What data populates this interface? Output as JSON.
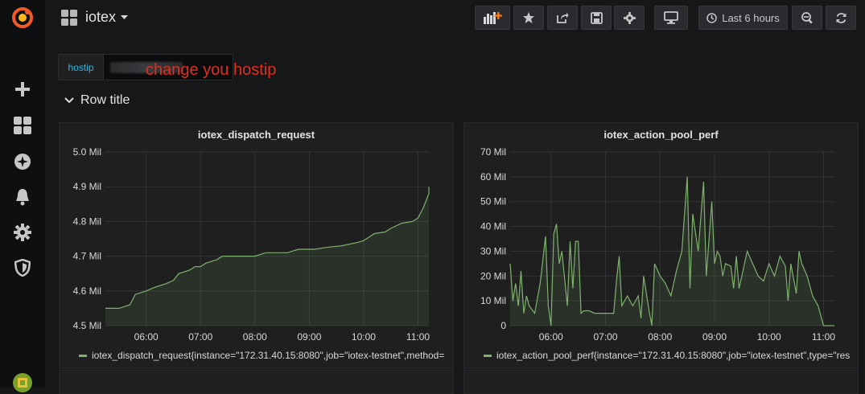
{
  "dashboard": {
    "title": "iotex"
  },
  "toolbar": {
    "time_range": "Last 6 hours"
  },
  "variable": {
    "label": "hostip"
  },
  "annotation": "change you hostip",
  "row": {
    "title": "Row title"
  },
  "colors": {
    "series": "#7eb26d",
    "accent": "#33b5e5",
    "annotation": "#e02f1f"
  },
  "panels": [
    {
      "title": "iotex_dispatch_request",
      "legend": "iotex_dispatch_request{instance=\"172.31.40.15:8080\",job=\"iotex-testnet\",method="
    },
    {
      "title": "iotex_action_pool_perf",
      "legend": "iotex_action_pool_perf{instance=\"172.31.40.15:8080\",job=\"iotex-testnet\",type=\"res"
    }
  ],
  "chart_data": [
    {
      "type": "area",
      "title": "iotex_dispatch_request",
      "y_tick_labels": [
        "4.5 Mil",
        "4.6 Mil",
        "4.7 Mil",
        "4.8 Mil",
        "4.9 Mil",
        "5.0 Mil"
      ],
      "x_tick_labels": [
        "06:00",
        "07:00",
        "08:00",
        "09:00",
        "10:00",
        "11:00"
      ],
      "ylim": [
        4.5,
        5.0
      ],
      "xlim": [
        5.25,
        11.2
      ],
      "series": [
        {
          "values": [
            [
              5.25,
              4.55
            ],
            [
              5.5,
              4.55
            ],
            [
              5.7,
              4.56
            ],
            [
              5.8,
              4.59
            ],
            [
              6.0,
              4.6
            ],
            [
              6.15,
              4.61
            ],
            [
              6.35,
              4.62
            ],
            [
              6.5,
              4.63
            ],
            [
              6.6,
              4.65
            ],
            [
              6.8,
              4.66
            ],
            [
              6.9,
              4.67
            ],
            [
              7.0,
              4.67
            ],
            [
              7.1,
              4.68
            ],
            [
              7.3,
              4.69
            ],
            [
              7.4,
              4.7
            ],
            [
              7.6,
              4.7
            ],
            [
              8.0,
              4.7
            ],
            [
              8.2,
              4.71
            ],
            [
              8.6,
              4.71
            ],
            [
              8.8,
              4.72
            ],
            [
              9.1,
              4.72
            ],
            [
              9.3,
              4.725
            ],
            [
              9.6,
              4.73
            ],
            [
              9.9,
              4.74
            ],
            [
              10.0,
              4.745
            ],
            [
              10.2,
              4.765
            ],
            [
              10.4,
              4.77
            ],
            [
              10.5,
              4.78
            ],
            [
              10.7,
              4.795
            ],
            [
              10.9,
              4.8
            ],
            [
              11.0,
              4.81
            ],
            [
              11.1,
              4.84
            ],
            [
              11.2,
              4.88
            ],
            [
              11.3,
              4.9
            ]
          ]
        }
      ]
    },
    {
      "type": "area",
      "title": "iotex_action_pool_perf",
      "y_tick_labels": [
        "0",
        "10 Mil",
        "20 Mil",
        "30 Mil",
        "40 Mil",
        "50 Mil",
        "60 Mil",
        "70 Mil"
      ],
      "x_tick_labels": [
        "06:00",
        "07:00",
        "08:00",
        "09:00",
        "10:00",
        "11:00"
      ],
      "ylim": [
        0,
        70
      ],
      "xlim": [
        5.25,
        11.2
      ],
      "series": [
        {
          "values": [
            [
              5.25,
              25
            ],
            [
              5.3,
              10
            ],
            [
              5.35,
              17
            ],
            [
              5.4,
              8
            ],
            [
              5.45,
              22
            ],
            [
              5.5,
              5
            ],
            [
              5.55,
              12
            ],
            [
              5.6,
              8
            ],
            [
              5.7,
              5
            ],
            [
              5.8,
              17
            ],
            [
              5.9,
              36
            ],
            [
              5.95,
              8
            ],
            [
              6.0,
              0
            ],
            [
              6.05,
              37
            ],
            [
              6.1,
              41
            ],
            [
              6.15,
              25
            ],
            [
              6.2,
              30
            ],
            [
              6.3,
              8
            ],
            [
              6.35,
              34
            ],
            [
              6.4,
              15
            ],
            [
              6.45,
              34
            ],
            [
              6.5,
              34
            ],
            [
              6.55,
              5
            ],
            [
              6.6,
              6
            ],
            [
              6.7,
              6
            ],
            [
              6.8,
              5
            ],
            [
              7.0,
              5
            ],
            [
              7.15,
              5
            ],
            [
              7.2,
              18
            ],
            [
              7.25,
              28
            ],
            [
              7.3,
              8
            ],
            [
              7.4,
              12
            ],
            [
              7.5,
              8
            ],
            [
              7.6,
              12
            ],
            [
              7.65,
              3
            ],
            [
              7.7,
              20
            ],
            [
              7.8,
              6
            ],
            [
              7.85,
              0
            ],
            [
              7.9,
              25
            ],
            [
              8.0,
              20
            ],
            [
              8.1,
              17
            ],
            [
              8.2,
              12
            ],
            [
              8.3,
              22
            ],
            [
              8.4,
              30
            ],
            [
              8.5,
              60
            ],
            [
              8.55,
              15
            ],
            [
              8.6,
              45
            ],
            [
              8.7,
              30
            ],
            [
              8.8,
              58
            ],
            [
              8.85,
              20
            ],
            [
              8.9,
              35
            ],
            [
              8.95,
              50
            ],
            [
              9.0,
              25
            ],
            [
              9.05,
              30
            ],
            [
              9.1,
              28
            ],
            [
              9.15,
              20
            ],
            [
              9.2,
              25
            ],
            [
              9.3,
              24
            ],
            [
              9.35,
              15
            ],
            [
              9.4,
              28
            ],
            [
              9.45,
              15
            ],
            [
              9.5,
              20
            ],
            [
              9.6,
              30
            ],
            [
              9.7,
              25
            ],
            [
              9.8,
              20
            ],
            [
              9.9,
              18
            ],
            [
              10.0,
              25
            ],
            [
              10.1,
              20
            ],
            [
              10.2,
              28
            ],
            [
              10.3,
              24
            ],
            [
              10.35,
              10
            ],
            [
              10.4,
              25
            ],
            [
              10.5,
              13
            ],
            [
              10.55,
              30
            ],
            [
              10.6,
              25
            ],
            [
              10.7,
              20
            ],
            [
              10.8,
              12
            ],
            [
              10.9,
              8
            ],
            [
              11.0,
              0
            ],
            [
              11.2,
              0
            ]
          ]
        }
      ]
    }
  ]
}
